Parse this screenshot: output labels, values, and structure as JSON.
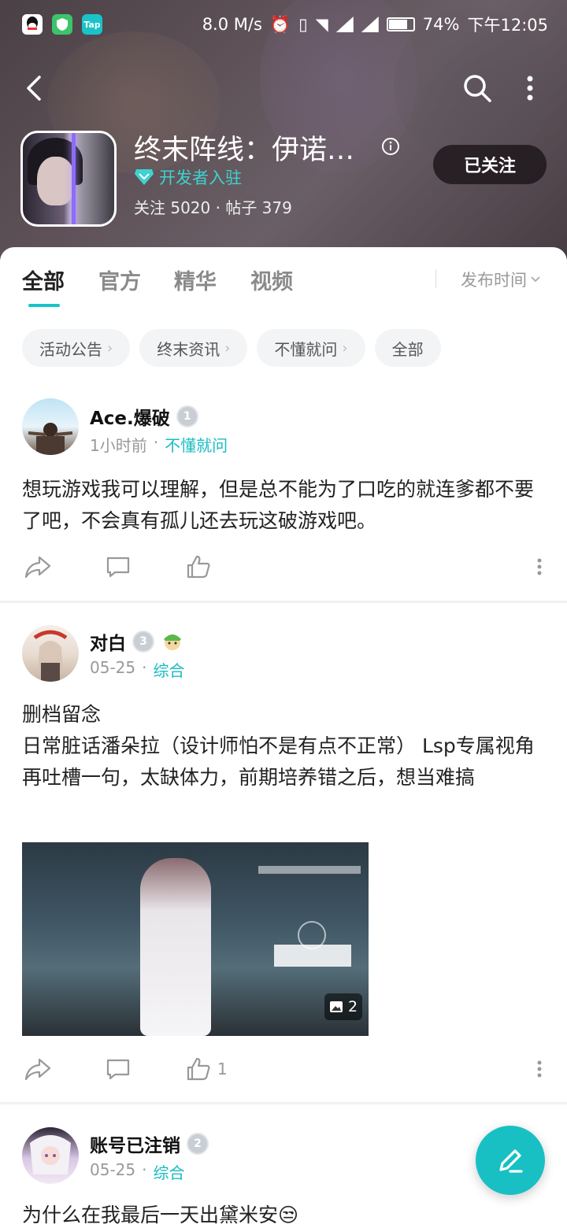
{
  "status_bar": {
    "speed": "8.0 M/s",
    "battery": "74%",
    "time": "下午12:05",
    "apps": [
      {
        "name": "qq-icon",
        "color": "#ffffff"
      },
      {
        "name": "shield-app-icon",
        "color": "#3cc46a"
      },
      {
        "name": "taptap-app-icon",
        "label": "Tap",
        "color": "#18c4c8"
      }
    ]
  },
  "header": {
    "game_title": "终末阵线：伊诺…",
    "dev_badge": "开发者入驻",
    "stats": "关注 5020 · 帖子 379",
    "follow_label": "已关注"
  },
  "tabs": [
    {
      "label": "全部",
      "active": true
    },
    {
      "label": "官方",
      "active": false
    },
    {
      "label": "精华",
      "active": false
    },
    {
      "label": "视频",
      "active": false
    }
  ],
  "sort_label": "发布时间",
  "chips": [
    {
      "label": "活动公告",
      "has_arrow": true
    },
    {
      "label": "终末资讯",
      "has_arrow": true
    },
    {
      "label": "不懂就问",
      "has_arrow": true
    },
    {
      "label": "全部",
      "has_arrow": false
    }
  ],
  "posts": [
    {
      "author": "Ace.爆破",
      "level": "1",
      "time": "1小时前",
      "category": "不懂就问",
      "body": "想玩游戏我可以理解，但是总不能为了口吃的就连爹都不要了吧，不会真有孤儿还去玩这破游戏吧。",
      "likes": ""
    },
    {
      "author": "对白",
      "level": "3",
      "time": "05-25",
      "category": "综合",
      "body_title": "删档留念",
      "body": "日常脏话潘朵拉（设计师怕不是有点不正常） Lsp专属视角 再吐槽一句，太缺体力，前期培养错之后，想当难搞",
      "image_count": "2",
      "likes": "1"
    },
    {
      "author": "账号已注销",
      "level": "2",
      "time": "05-25",
      "category": "综合",
      "body": "为什么在我最后一天出黛米安😒"
    }
  ],
  "colors": {
    "accent": "#18c0c4",
    "header_bg": "#564a50"
  }
}
